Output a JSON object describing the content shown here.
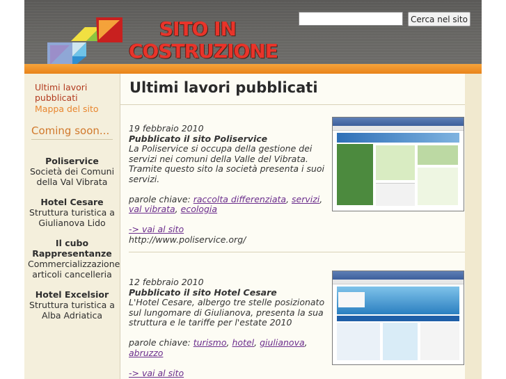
{
  "header": {
    "logo_line1": "SITO IN",
    "logo_line2": "COSTRUZIONE",
    "search_value": "",
    "search_button": "Cerca nel sito",
    "accent_orange": "#f29a33",
    "logo_red": "#e8342a"
  },
  "nav": {
    "item1": "Ultimi lavori pubblicati",
    "item2": "Mappa del sito"
  },
  "coming_soon": {
    "heading": "Coming soon...",
    "items": [
      {
        "name": "Poliservice",
        "desc": "Società dei Comuni della Val Vibrata"
      },
      {
        "name": "Hotel Cesare",
        "desc": "Struttura turistica a Giulianova Lido"
      },
      {
        "name": "Il cubo Rappresentanze",
        "desc": "Commercializzazione articoli cancelleria"
      },
      {
        "name": "Hotel Excelsior",
        "desc": "Struttura turistica a Alba Adriatica"
      }
    ]
  },
  "main": {
    "title": "Ultimi lavori pubblicati",
    "posts": [
      {
        "date": "19 febbraio 2010",
        "title": "Pubblicato il sito Poliservice",
        "body1": "La Poliservice si occupa della gestione dei servizi nei comuni della Valle del Vibrata.",
        "body2": "Tramite questo sito la società presenta i suoi servizi.",
        "keywords_label": "parole chiave:",
        "keywords": [
          "raccolta differenziata",
          "servizi",
          "val vibrata",
          "ecologia"
        ],
        "link_text": "-> vai al sito",
        "url": "http://www.poliservice.org/"
      },
      {
        "date": "12 febbraio 2010",
        "title": "Pubblicato il sito Hotel Cesare",
        "body1": "L'Hotel Cesare, albergo tre stelle posizionato sul lungomare di Giulianova, presenta la sua struttura e le tariffe per l'estate 2010",
        "keywords_label": "parole chiave:",
        "keywords": [
          "turismo",
          "hotel",
          "giulianova",
          "abruzzo"
        ],
        "link_text": "-> vai al sito"
      }
    ]
  }
}
